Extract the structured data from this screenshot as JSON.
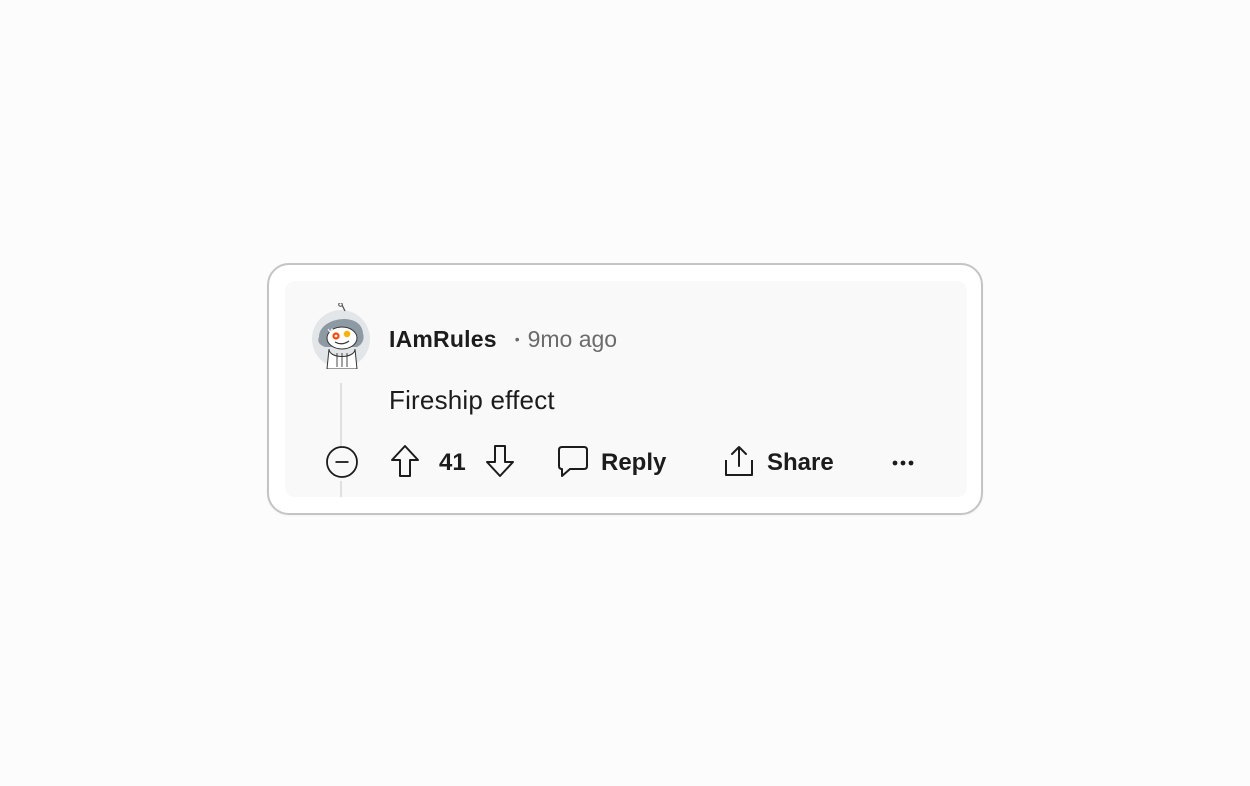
{
  "comment": {
    "username": "IAmRules",
    "separator": "•",
    "timestamp": "9mo ago",
    "body": "Fireship effect",
    "score": "41"
  },
  "actions": {
    "reply_label": "Reply",
    "share_label": "Share"
  },
  "icons": {
    "collapse": "collapse-minus-icon",
    "upvote": "upvote-arrow-icon",
    "downvote": "downvote-arrow-icon",
    "reply": "comment-bubble-icon",
    "share": "share-upload-icon",
    "more": "more-options-icon"
  },
  "colors": {
    "card_background": "#ffffff",
    "comment_background": "#f9f9f9",
    "card_border": "#c4c4c4",
    "text_primary": "#1c1c1c",
    "text_secondary": "#6b6b6b"
  }
}
